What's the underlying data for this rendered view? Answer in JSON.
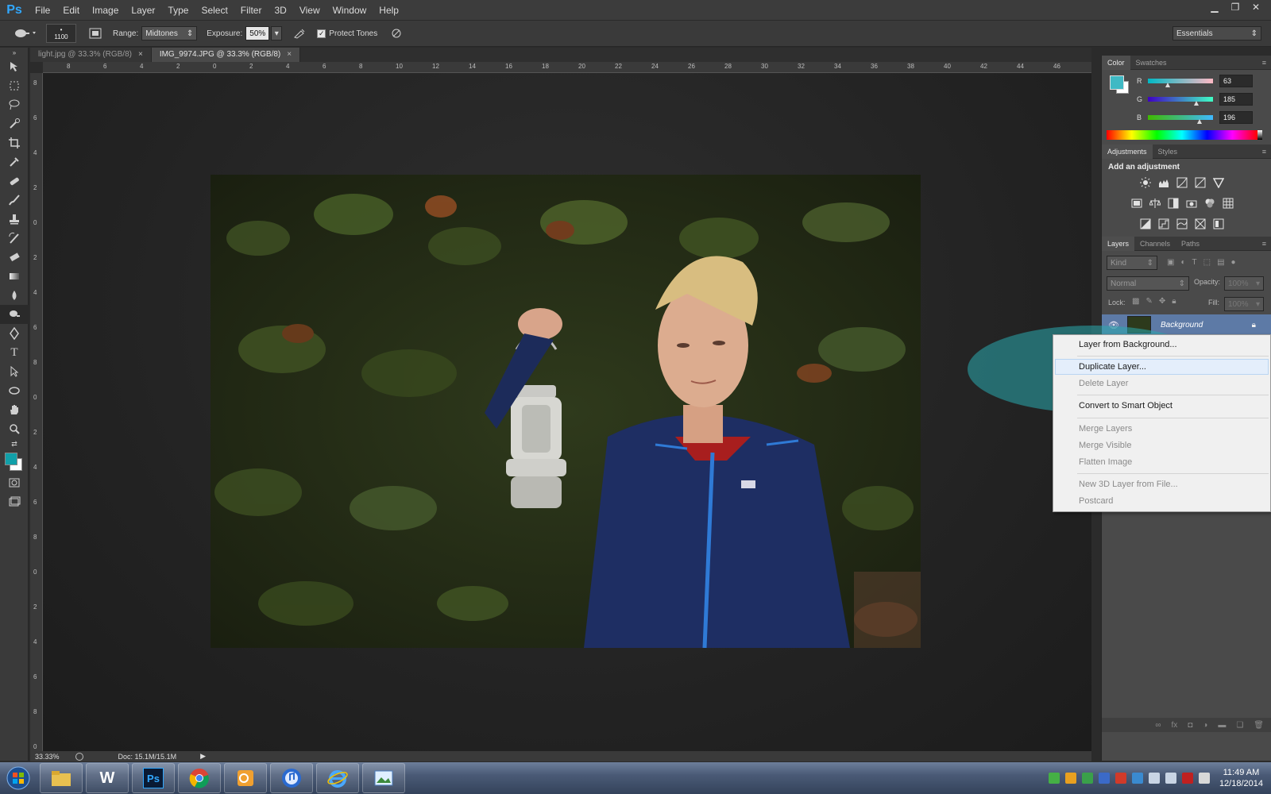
{
  "app": {
    "logo": "Ps"
  },
  "menubar": {
    "items": [
      "File",
      "Edit",
      "Image",
      "Layer",
      "Type",
      "Select",
      "Filter",
      "3D",
      "View",
      "Window",
      "Help"
    ]
  },
  "window_controls": {
    "minimize": "▁",
    "restore": "❐",
    "close": "✕"
  },
  "options": {
    "brush_size": "1100",
    "range_label": "Range:",
    "range_value": "Midtones",
    "exposure_label": "Exposure:",
    "exposure_value": "50%",
    "protect_tones_label": "Protect Tones",
    "protect_tones_checked": true,
    "workspace": "Essentials"
  },
  "tabs": [
    {
      "label": "light.jpg @ 33.3% (RGB/8)",
      "active": false
    },
    {
      "label": "IMG_9974.JPG @ 33.3% (RGB/8)",
      "active": true
    }
  ],
  "ruler": {
    "h_labels": [
      "8",
      "6",
      "4",
      "2",
      "0",
      "2",
      "4",
      "6",
      "8",
      "10",
      "12",
      "14",
      "16",
      "18",
      "20",
      "22",
      "24",
      "26",
      "28",
      "30",
      "32",
      "34",
      "36",
      "38",
      "40",
      "42",
      "44",
      "46"
    ],
    "v_labels": [
      "8",
      "6",
      "4",
      "2",
      "0",
      "2",
      "4",
      "6",
      "8",
      "0",
      "2",
      "4",
      "6",
      "8",
      "0",
      "2",
      "4",
      "6",
      "8",
      "0"
    ]
  },
  "status": {
    "zoom": "33.33%",
    "doc": "Doc: 15.1M/15.1M"
  },
  "color_panel": {
    "tabs": [
      "Color",
      "Swatches"
    ],
    "foreground": "#3fb9c4",
    "r": "63",
    "g": "185",
    "b": "196",
    "r_label": "R",
    "g_label": "G",
    "b_label": "B"
  },
  "adjustments_panel": {
    "tabs": [
      "Adjustments",
      "Styles"
    ],
    "heading": "Add an adjustment"
  },
  "layers_panel": {
    "tabs": [
      "Layers",
      "Channels",
      "Paths"
    ],
    "filter_kind": "Kind",
    "blend_mode": "Normal",
    "opacity_label": "Opacity:",
    "opacity_value": "100%",
    "lock_label": "Lock:",
    "fill_label": "Fill:",
    "fill_value": "100%",
    "layer_name": "Background"
  },
  "context_menu": {
    "items": [
      {
        "label": "Layer from Background...",
        "disabled": false
      },
      {
        "label": "Duplicate Layer...",
        "disabled": false,
        "highlighted": true
      },
      {
        "label": "Delete Layer",
        "disabled": true
      },
      {
        "label": "Convert to Smart Object",
        "disabled": false
      },
      {
        "label": "Merge Layers",
        "disabled": true
      },
      {
        "label": "Merge Visible",
        "disabled": true
      },
      {
        "label": "Flatten Image",
        "disabled": true
      },
      {
        "label": "New 3D Layer from File...",
        "disabled": true
      },
      {
        "label": "Postcard",
        "disabled": true
      }
    ]
  },
  "taskbar": {
    "apps": [
      "windows-explorer-icon",
      "word-icon",
      "photoshop-icon",
      "chrome-icon",
      "outlook-icon",
      "itunes-icon",
      "internet-explorer-icon",
      "photo-viewer-icon"
    ],
    "word_letter": "W",
    "ps_letter": "Ps",
    "clock_time": "11:49 AM",
    "clock_date": "12/18/2014"
  }
}
